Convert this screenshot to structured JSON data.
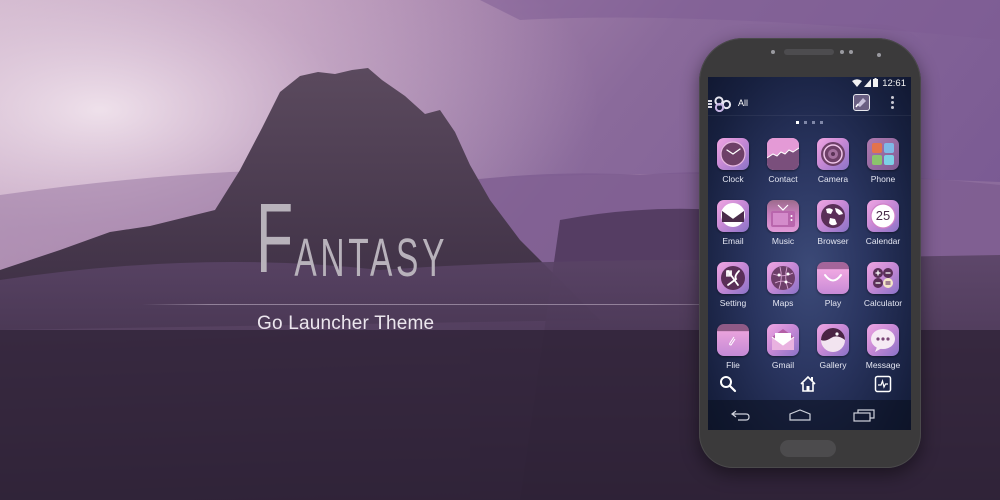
{
  "banner": {
    "title_initial": "F",
    "title_rest": "ANTASY",
    "subtitle": "Go Launcher Theme"
  },
  "colors": {
    "accent_pink": "#e9a3dc",
    "accent_purple": "#8a72c7",
    "screen_bg": "#1c2547",
    "phone_body": "#3b3a3b",
    "title_text": "#b8b2bb"
  },
  "phone": {
    "status_bar": {
      "icons": [
        "wifi-icon",
        "signal-icon",
        "battery-icon"
      ],
      "time": "12:61"
    },
    "app_bar": {
      "menu_icon": "hamburger-icon",
      "logo_icon": "go-launcher-logo-icon",
      "filter_label": "All",
      "theme_icon": "theme-icon",
      "more_icon": "more-vertical-icon"
    },
    "pager": {
      "pages": 4,
      "active_page": 1
    },
    "apps": [
      {
        "label": "Clock",
        "icon": "clock-icon"
      },
      {
        "label": "Contact",
        "icon": "contact-icon"
      },
      {
        "label": "Camera",
        "icon": "camera-icon"
      },
      {
        "label": "Phone",
        "icon": "phone-folder-icon"
      },
      {
        "label": "Email",
        "icon": "email-icon"
      },
      {
        "label": "Music",
        "icon": "music-tv-icon"
      },
      {
        "label": "Browser",
        "icon": "browser-globe-icon"
      },
      {
        "label": "Calendar",
        "icon": "calendar-icon",
        "badge": "25"
      },
      {
        "label": "Setting",
        "icon": "setting-icon"
      },
      {
        "label": "Maps",
        "icon": "maps-icon"
      },
      {
        "label": "Play",
        "icon": "play-store-icon"
      },
      {
        "label": "Calculator",
        "icon": "calculator-icon"
      },
      {
        "label": "Flie",
        "icon": "file-icon"
      },
      {
        "label": "Gmail",
        "icon": "gmail-icon"
      },
      {
        "label": "Gallery",
        "icon": "gallery-icon"
      },
      {
        "label": "Message",
        "icon": "message-icon"
      }
    ],
    "dock": [
      {
        "icon": "search-icon"
      },
      {
        "icon": "home-icon"
      },
      {
        "icon": "activity-icon"
      }
    ],
    "nav": [
      {
        "icon": "back-icon"
      },
      {
        "icon": "home-nav-icon"
      },
      {
        "icon": "recent-apps-icon"
      }
    ]
  }
}
